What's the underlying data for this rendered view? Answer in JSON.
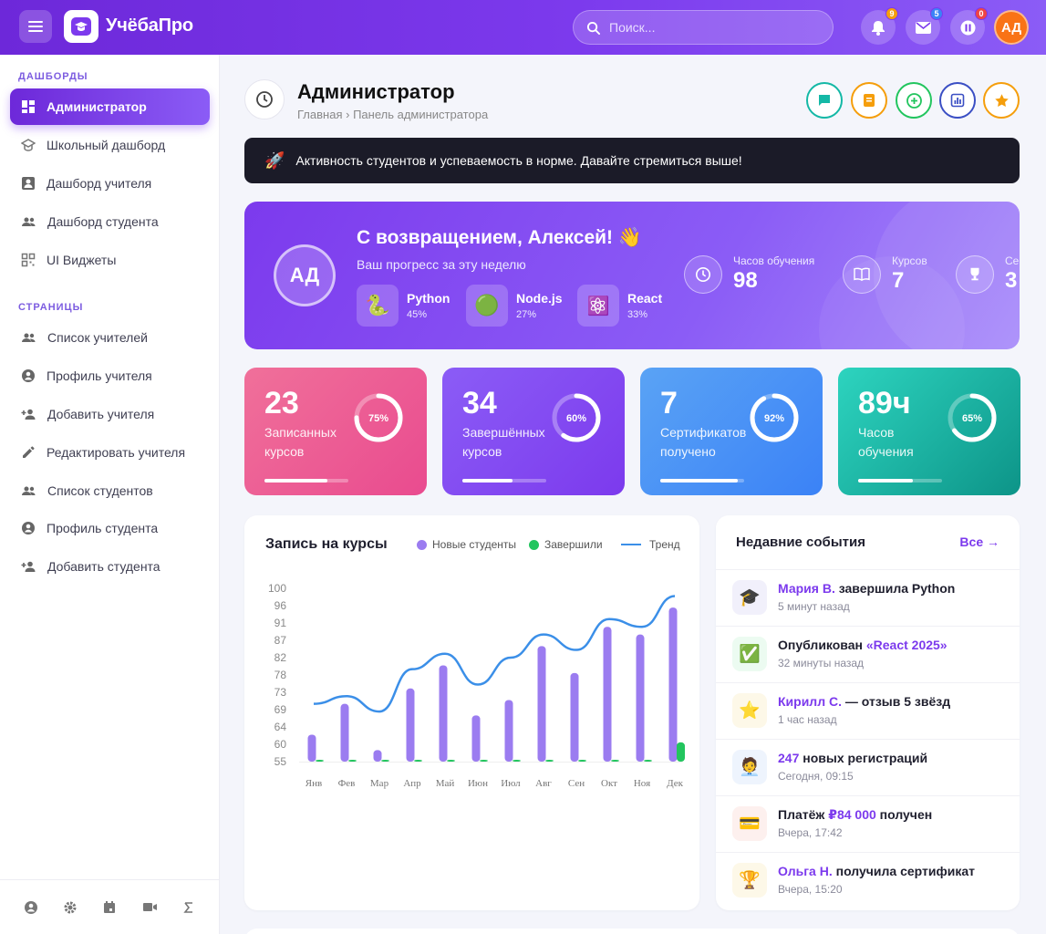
{
  "app": {
    "brand": "УчёбаПро",
    "search_placeholder": "Поиск...",
    "user_initials": "АД"
  },
  "notifications": {
    "bell": "9",
    "mail": "5",
    "status": "0"
  },
  "sidebar": {
    "section_dashboards": "ДАШБОРДЫ",
    "dashboards": [
      {
        "label": "Администратор",
        "icon": "dashboard-icon",
        "active": true
      },
      {
        "label": "Школьный дашборд",
        "icon": "school-icon"
      },
      {
        "label": "Дашборд учителя",
        "icon": "teacher-icon"
      },
      {
        "label": "Дашборд студента",
        "icon": "students-icon"
      },
      {
        "label": "UI Виджеты",
        "icon": "widgets-icon"
      }
    ],
    "section_pages": "СТРАНИЦЫ",
    "pages": [
      {
        "label": "Список учителей",
        "icon": "people-icon"
      },
      {
        "label": "Профиль учителя",
        "icon": "profile-icon"
      },
      {
        "label": "Добавить учителя",
        "icon": "add-person-icon"
      },
      {
        "label": "Редактировать учителя",
        "icon": "edit-icon"
      },
      {
        "label": "Список студентов",
        "icon": "people-icon"
      },
      {
        "label": "Профиль студента",
        "icon": "profile-icon"
      },
      {
        "label": "Добавить студента",
        "icon": "add-person-icon"
      }
    ]
  },
  "header": {
    "title": "Администратор",
    "crumb_home": "Главная",
    "crumb_sep": "›",
    "crumb_current": "Панель администратора"
  },
  "alert": {
    "icon": "🚀",
    "text": "Активность студентов и успеваемость в норме. Давайте стремиться выше!"
  },
  "hero": {
    "initials": "АД",
    "greeting": "С возвращением, Алексей! 👋",
    "subtitle": "Ваш прогресс за эту неделю",
    "courses": [
      {
        "name": "Python",
        "progress": "45%",
        "icon": "🐍"
      },
      {
        "name": "Node.js",
        "progress": "27%",
        "icon": "🟢"
      },
      {
        "name": "React",
        "progress": "33%",
        "icon": "⚛️"
      }
    ],
    "stats": [
      {
        "label": "Часов обучения",
        "value": "98",
        "icon": "clock-icon"
      },
      {
        "label": "Курсов",
        "value": "7",
        "icon": "book-icon"
      },
      {
        "label": "Се",
        "value": "3",
        "icon": "trophy-icon"
      }
    ]
  },
  "cards": [
    {
      "value": "23",
      "label1": "Записанных",
      "label2": "курсов",
      "percent": "75%",
      "fraction": 0.75,
      "color1": "#f0709a",
      "color2": "#e94b8f"
    },
    {
      "value": "34",
      "label1": "Завершённых",
      "label2": "курсов",
      "percent": "60%",
      "fraction": 0.6,
      "color1": "#8b5cf6",
      "color2": "#7c3aed"
    },
    {
      "value": "7",
      "label1": "Сертификатов",
      "label2": "получено",
      "percent": "92%",
      "fraction": 0.92,
      "color1": "#5aa3f5",
      "color2": "#3b82f6"
    },
    {
      "value": "89ч",
      "label1": "Часов",
      "label2": "обучения",
      "percent": "65%",
      "fraction": 0.65,
      "color1": "#2dd4bf",
      "color2": "#0d9488"
    }
  ],
  "chart_data": {
    "type": "bar",
    "title": "Запись на курсы",
    "categories": [
      "Янв",
      "Фев",
      "Мар",
      "Апр",
      "Май",
      "Июн",
      "Июл",
      "Авг",
      "Сен",
      "Окт",
      "Ноя",
      "Дек"
    ],
    "yticks": [
      "100",
      "96",
      "91",
      "87",
      "82",
      "78",
      "73",
      "69",
      "64",
      "60",
      "55"
    ],
    "ylim": [
      55,
      100
    ],
    "series": [
      {
        "name": "Новые студенты",
        "type": "bar",
        "color": "#9b7cf0",
        "values": [
          62,
          70,
          58,
          74,
          80,
          67,
          71,
          85,
          78,
          90,
          88,
          95
        ]
      },
      {
        "name": "Завершили",
        "type": "bar",
        "color": "#22c55e",
        "values": [
          55,
          55,
          55,
          55,
          55,
          55,
          55,
          55,
          55,
          55,
          55,
          60
        ]
      },
      {
        "name": "Тренд",
        "type": "line",
        "color": "#3b8fe8",
        "values": [
          70,
          72,
          68,
          79,
          83,
          75,
          82,
          88,
          84,
          92,
          90,
          98
        ]
      }
    ]
  },
  "events": {
    "title": "Недавние события",
    "all_link": "Все →",
    "items": [
      {
        "icon": "🎓",
        "bg": "#f1f0fb",
        "highlight": "Мария В.",
        "text": " завершила Python",
        "time": "5 минут назад"
      },
      {
        "icon": "✅",
        "bg": "#ecfbf1",
        "highlight": "",
        "text": "Опубликован ",
        "highlight2": "«React 2025»",
        "time": "32 минуты назад"
      },
      {
        "icon": "⭐",
        "bg": "#fdf8e8",
        "highlight": "Кирилл С.",
        "text": " — отзыв 5 звёзд",
        "time": "1 час назад"
      },
      {
        "icon": "🧑‍💼",
        "bg": "#eef4fd",
        "highlight": "247",
        "text": " новых регистраций",
        "time": "Сегодня, 09:15"
      },
      {
        "icon": "💳",
        "bg": "#fdf0ee",
        "highlight": "",
        "text": "Платёж ",
        "highlight2": "₽84 000",
        "text2": " получен",
        "time": "Вчера, 17:42"
      },
      {
        "icon": "🏆",
        "bg": "#fdf8e8",
        "highlight": "Ольга Н.",
        "text": " получила сертификат",
        "time": "Вчера, 15:20"
      }
    ]
  }
}
